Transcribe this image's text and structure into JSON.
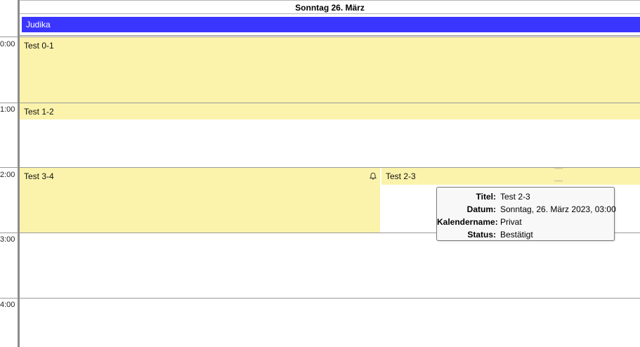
{
  "header": {
    "day_title": "Sonntag 26. März"
  },
  "allday": {
    "event_title": "Judika",
    "color": "#3a36ff"
  },
  "time_labels": [
    "0:00",
    "1:00",
    "2:00",
    "3:00",
    "4:00"
  ],
  "events": [
    {
      "title": "Test 0-1",
      "color": "#fbf3ab"
    },
    {
      "title": "Test 1-2",
      "color": "#fbf3ab"
    },
    {
      "title": "Test 3-4",
      "color": "#fbf3ab",
      "icon": "bell-icon"
    },
    {
      "title": "Test 2-3",
      "color": "#fbf3ab"
    }
  ],
  "tooltip": {
    "rows": [
      {
        "key": "Titel:",
        "value": "Test 2-3"
      },
      {
        "key": "Datum:",
        "value": "Sonntag, 26. März 2023, 03:00"
      },
      {
        "key": "Kalendername:",
        "value": "Privat"
      },
      {
        "key": "Status:",
        "value": "Bestätigt"
      }
    ]
  }
}
